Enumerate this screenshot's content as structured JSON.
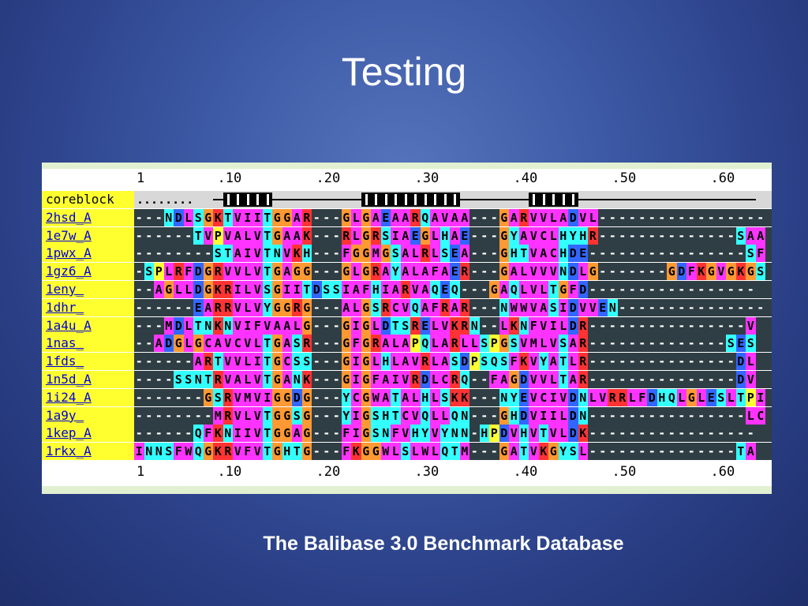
{
  "slide": {
    "title": "Testing",
    "caption": "The Balibase 3.0 Benchmark Database"
  },
  "alignment": {
    "ruler_labels": [
      "1",
      ".10",
      ".20",
      ".30",
      ".40",
      ".50",
      ".60"
    ],
    "ruler_columns": [
      1,
      10,
      20,
      30,
      40,
      50,
      60
    ],
    "coreblock_label": "coreblock",
    "coreblock_dots": "........",
    "core_ranges": [
      [
        10,
        14
      ],
      [
        24,
        33
      ],
      [
        41,
        45
      ]
    ],
    "sequences": [
      {
        "name": "2hsd_A",
        "residues": "---NDLSGKTVIITGGAR---GLGAEAARQAVAA---GARVVLADVL-----------------"
      },
      {
        "name": "1e7w_A",
        "residues": "------TVPVALVTGAAK---RLGRSIAEGLHAE---GYAVCLHYHR--------------SAA"
      },
      {
        "name": "1pwx_A",
        "residues": "--------STAIVTNVKH---FGGMGSALRLSEA---GHTVACHDE----------------SF"
      },
      {
        "name": "1gz6_A",
        "residues": "-SPLRFDGRVVLVTGAGG---GLGRAYALAFAER---GALVVVNDLG-------GDFKGVGKGS"
      },
      {
        "name": "1eny_",
        "residues": "--AGLLDGKRILVSGIITDSSIAFHIARVAQEQ---GAQLVLTGFD-----------------"
      },
      {
        "name": "1dhr_",
        "residues": "------EARRVLVYGGRG---ALGSRCVQAFRAR---NWWVASIDVVEN---------------"
      },
      {
        "name": "1a4u_A",
        "residues": "---MDLTNKNVIFVAALG---GIGLDTSRELVKRN--LKNFVILDR----------------V"
      },
      {
        "name": "1nas_",
        "residues": "--ADGLGCAVCVLTGASR---GFGRALAPQLARLLSPGSVMLVSAR--------------SES"
      },
      {
        "name": "1fds_",
        "residues": "------ARTVVLITGCSS---GIGLHLAVRLASDPSQSFKVYATLR---------------DL"
      },
      {
        "name": "1n5d_A",
        "residues": "----SSNTRVALVTGANK---GIGFAIVRDLCRQ--FAGDVVLTAR---------------DV"
      },
      {
        "name": "1i24_A",
        "residues": "-------GSRVMVIGGDG---YCGWATALHLSKK---NYEVCIVDNLVRRLFDHQLGLESLTPI"
      },
      {
        "name": "1a9y_",
        "residues": "--------MRVLVTGGSG---YIGSHTCVQLLQN---GHDVIILDN----------------LC"
      },
      {
        "name": "1kep_A",
        "residues": "------QFKNIIVTGGAG---FIGSNFVHYVYNN-HPDVHVTVLDK-----------------"
      },
      {
        "name": "1rkx_A",
        "residues": "INNSFWQGKRVFVTGHTG---FKGGWLSLWLQTM---GATVKGYSL---------------TA"
      }
    ],
    "colors": {
      "G": "#ff9933",
      "A": "#ff33ff",
      "V": "#ff33ff",
      "L": "#ff33ff",
      "I": "#ff33ff",
      "M": "#ff33ff",
      "F": "#ff33ff",
      "W": "#ff33ff",
      "C": "#ff33ff",
      "Y": "#33ffff",
      "H": "#33ffff",
      "N": "#33ffff",
      "Q": "#33ffff",
      "S": "#33ffff",
      "T": "#33ffff",
      "K": "#ff3333",
      "R": "#ff3333",
      "D": "#3366ff",
      "E": "#3366ff",
      "P": "#ffff33",
      "gap": "#2f3e44",
      "label_bg": "#ffff30",
      "link": "#0000dd"
    }
  }
}
